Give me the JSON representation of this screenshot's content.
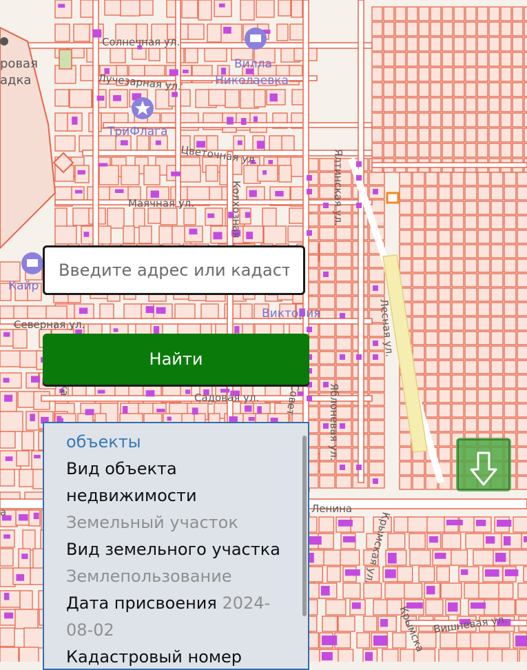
{
  "map": {
    "street_labels": {
      "solnechnaya": "Солнечная ул.",
      "luchezarnaya": "Лучезарная ул.",
      "tsvetochnaya": "Цветочная ул.",
      "mayachnaya": "Маячная ул.",
      "kolkhoznaya": "Колхозная",
      "yaltinskaya": "Ялтинская ул.",
      "severnaya": "Северная ул.",
      "sadovaya": "Садовая ул.",
      "lesnaya": "Лесная ул.",
      "yablonevaya": "Яблоневая ул.",
      "lenina": "Ленина",
      "krymskaya": "Крымская ул.",
      "krymskaya2": "Крымска",
      "vishnevaya": "Вишневая ул.",
      "sovetskaya": "Совет",
      "left_ka": "ка",
      "left_a": "а"
    },
    "poi_labels": {
      "villa_line1": "Вилла",
      "villa_line2": "Николаевка",
      "triflaga": "ТриФлага",
      "viktoriya": "Виктория",
      "kairos": "Кайр",
      "park_line1": "ровая",
      "park_line2": "адка"
    },
    "colors": {
      "parcel_stroke": "#e8644a",
      "parcel_fill": "#fbe4dc",
      "building": "#c44be0",
      "road": "#ffffff",
      "highlight": "#f5eeb0"
    }
  },
  "search": {
    "placeholder": "Введите адрес или кадастровый номер"
  },
  "find_button": {
    "label": "Найти"
  },
  "info_panel": {
    "header": "объекты",
    "rows": [
      {
        "label": "Вид объекта",
        "value": ""
      },
      {
        "label": "недвижимости",
        "value": ""
      },
      {
        "label": "",
        "value": "Земельный участок"
      },
      {
        "label": "Вид земельного участка",
        "value": ""
      },
      {
        "label": "",
        "value": "Землепользование"
      },
      {
        "label": "Дата присвоения ",
        "value": "2024-"
      },
      {
        "label": "",
        "value": "08-02"
      },
      {
        "label": "Кадастровый номер",
        "value": ""
      }
    ]
  },
  "controls": {
    "down_icon": "arrow-down-icon"
  }
}
